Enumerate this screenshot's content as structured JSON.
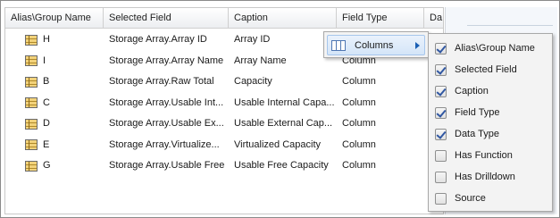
{
  "grid": {
    "columns": [
      "Alias\\Group Name",
      "Selected Field",
      "Caption",
      "Field Type",
      "Da"
    ],
    "rows": [
      {
        "alias": "H",
        "field": "Storage Array.Array ID",
        "caption": "Array ID",
        "type": "Column"
      },
      {
        "alias": "I",
        "field": "Storage Array.Array Name",
        "caption": "Array Name",
        "type": "Column"
      },
      {
        "alias": "B",
        "field": "Storage Array.Raw Total",
        "caption": "Capacity",
        "type": "Column"
      },
      {
        "alias": "C",
        "field": "Storage Array.Usable Int...",
        "caption": "Usable Internal Capa...",
        "type": "Column"
      },
      {
        "alias": "D",
        "field": "Storage Array.Usable Ex...",
        "caption": "Usable External Cap...",
        "type": "Column"
      },
      {
        "alias": "E",
        "field": "Storage Array.Virtualize...",
        "caption": "Virtualized Capacity",
        "type": "Column"
      },
      {
        "alias": "G",
        "field": "Storage Array.Usable Free",
        "caption": "Usable Free Capacity",
        "type": "Column"
      }
    ]
  },
  "context_menu": {
    "columns_label": "Columns",
    "columns_icon": "columns-icon",
    "submenu_icon": "chevron-right-icon"
  },
  "columns_submenu": {
    "items": [
      {
        "label": "Alias\\Group Name",
        "checked": true
      },
      {
        "label": "Selected Field",
        "checked": true
      },
      {
        "label": "Caption",
        "checked": true
      },
      {
        "label": "Field Type",
        "checked": true
      },
      {
        "label": "Data Type",
        "checked": true
      },
      {
        "label": "Has Function",
        "checked": false
      },
      {
        "label": "Has Drilldown",
        "checked": false
      },
      {
        "label": "Source",
        "checked": false
      }
    ]
  }
}
